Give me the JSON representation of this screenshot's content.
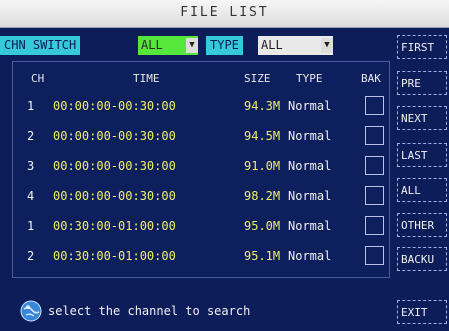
{
  "title": "FILE LIST",
  "filter": {
    "channel_label": "CHN SWITCH",
    "channel_value": "ALL",
    "type_label": "TYPE",
    "type_value": "ALL"
  },
  "columns": {
    "ch": "CH",
    "time": "TIME",
    "size": "SIZE",
    "type": "TYPE",
    "bak": "BAK"
  },
  "rows": [
    {
      "ch": "1",
      "time": "00:00:00-00:30:00",
      "size": "94.3M",
      "type": "Normal"
    },
    {
      "ch": "2",
      "time": "00:00:00-00:30:00",
      "size": "94.5M",
      "type": "Normal"
    },
    {
      "ch": "3",
      "time": "00:00:00-00:30:00",
      "size": "91.0M",
      "type": "Normal"
    },
    {
      "ch": "4",
      "time": "00:00:00-00:30:00",
      "size": "98.2M",
      "type": "Normal"
    },
    {
      "ch": "1",
      "time": "00:30:00-01:00:00",
      "size": "95.0M",
      "type": "Normal"
    },
    {
      "ch": "2",
      "time": "00:30:00-01:00:00",
      "size": "95.1M",
      "type": "Normal"
    }
  ],
  "side_buttons": {
    "first": "FIRST",
    "pre": "PRE",
    "next": "NEXT",
    "last": "LAST",
    "all": "ALL",
    "other": "OTHER",
    "backup": "BACKU",
    "exit": "EXIT"
  },
  "status_message": "select the channel to search",
  "colors": {
    "background": "#0d1d5a",
    "time_text": "#f0f067",
    "channel_highlight": "#55e73c",
    "label_highlight": "#36c9d8"
  },
  "icons": {
    "status": "info-globe-icon",
    "dropdown": "chevron-down-icon"
  }
}
